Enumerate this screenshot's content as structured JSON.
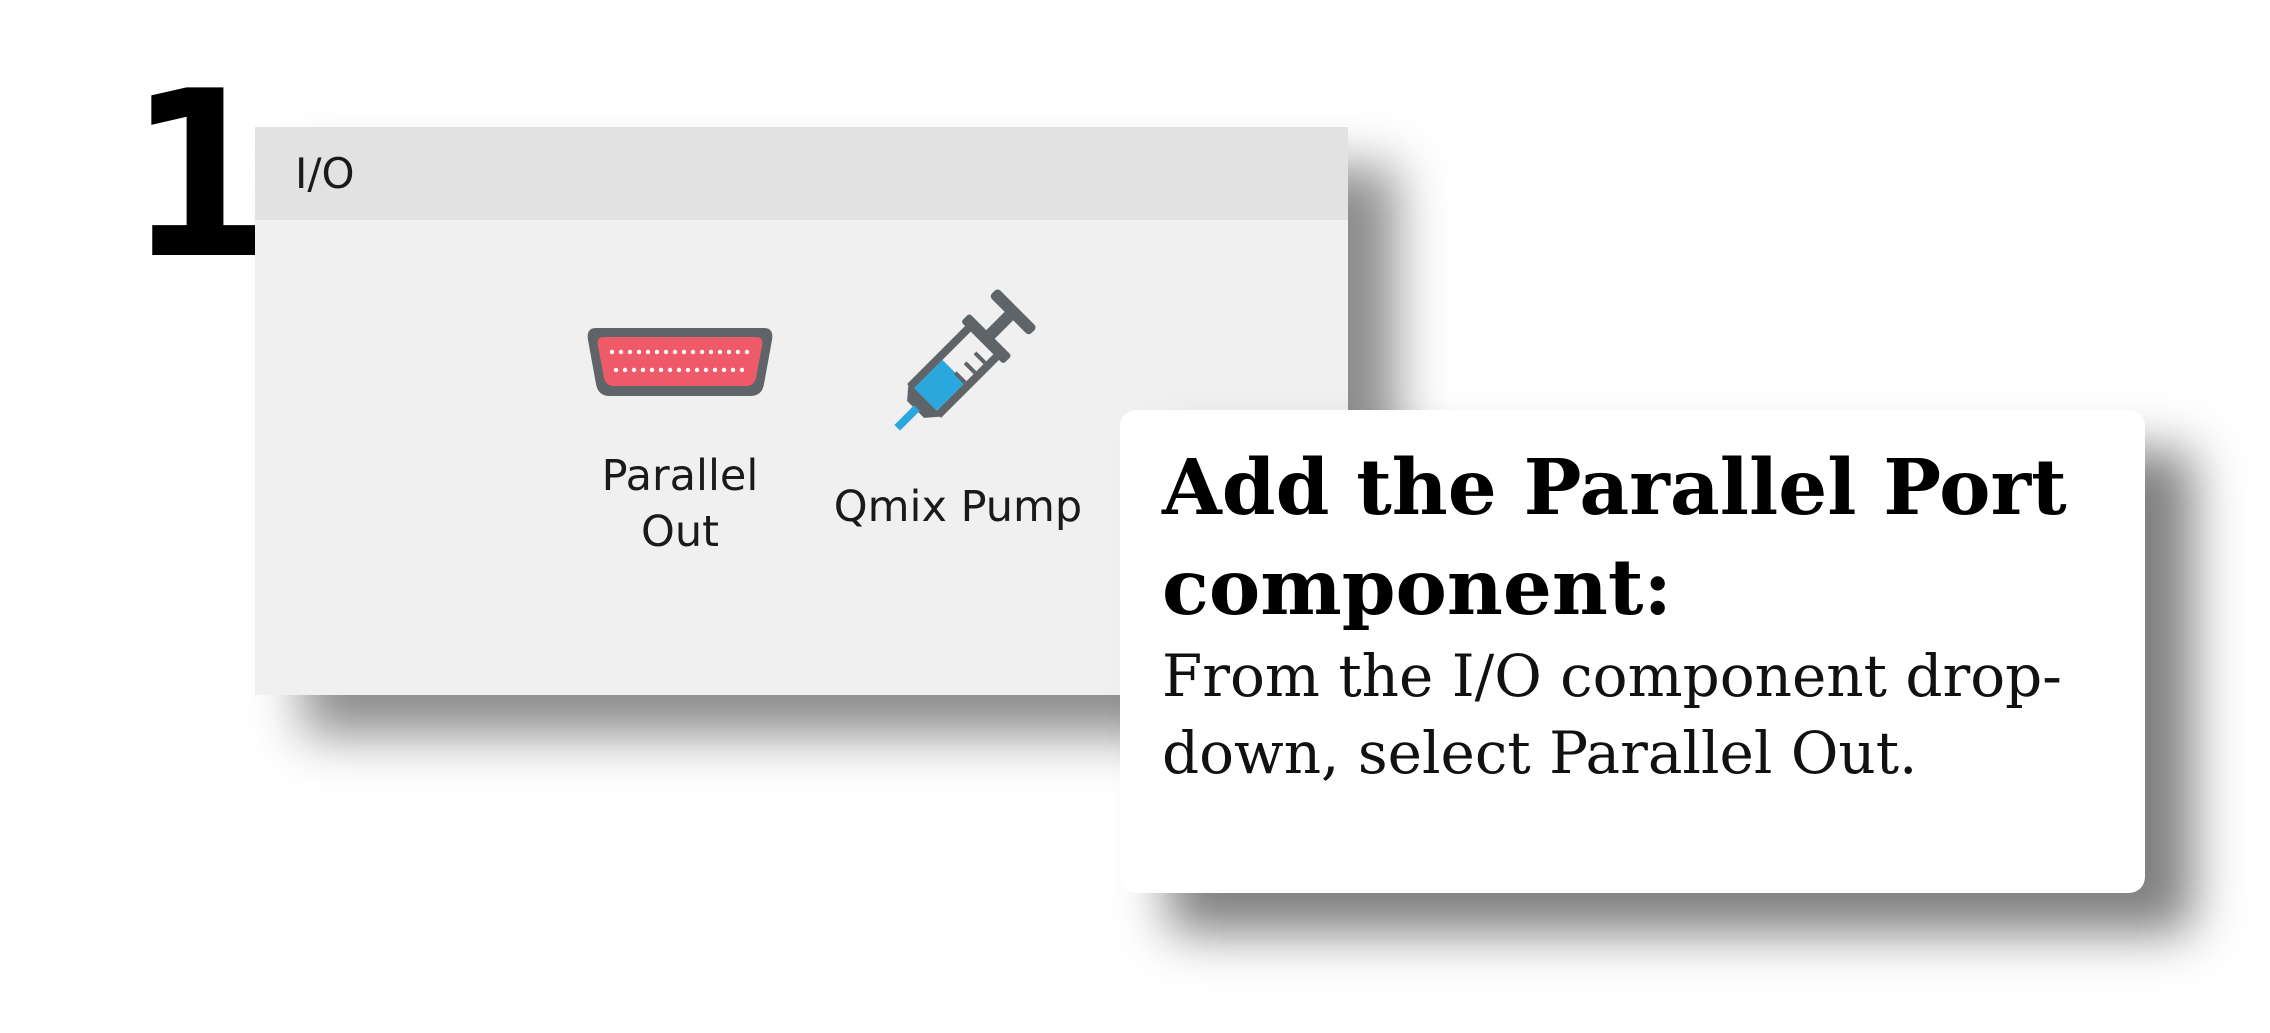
{
  "step": {
    "number": "1"
  },
  "panel": {
    "title": "I/O",
    "items": [
      {
        "label": "Parallel\nOut",
        "icon": "parallel-port-icon"
      },
      {
        "label": "Qmix Pump",
        "icon": "syringe-pump-icon"
      }
    ]
  },
  "callout": {
    "heading": "Add the Parallel Port component:",
    "body": "From the I/O component drop-down, select Parallel Out."
  },
  "colors": {
    "panel_bg": "#f0f0f0",
    "panel_header_bg": "#e2e2e2",
    "port_red": "#ee5a67",
    "syringe_blue": "#2aa7dd",
    "icon_gray": "#5f6469"
  }
}
